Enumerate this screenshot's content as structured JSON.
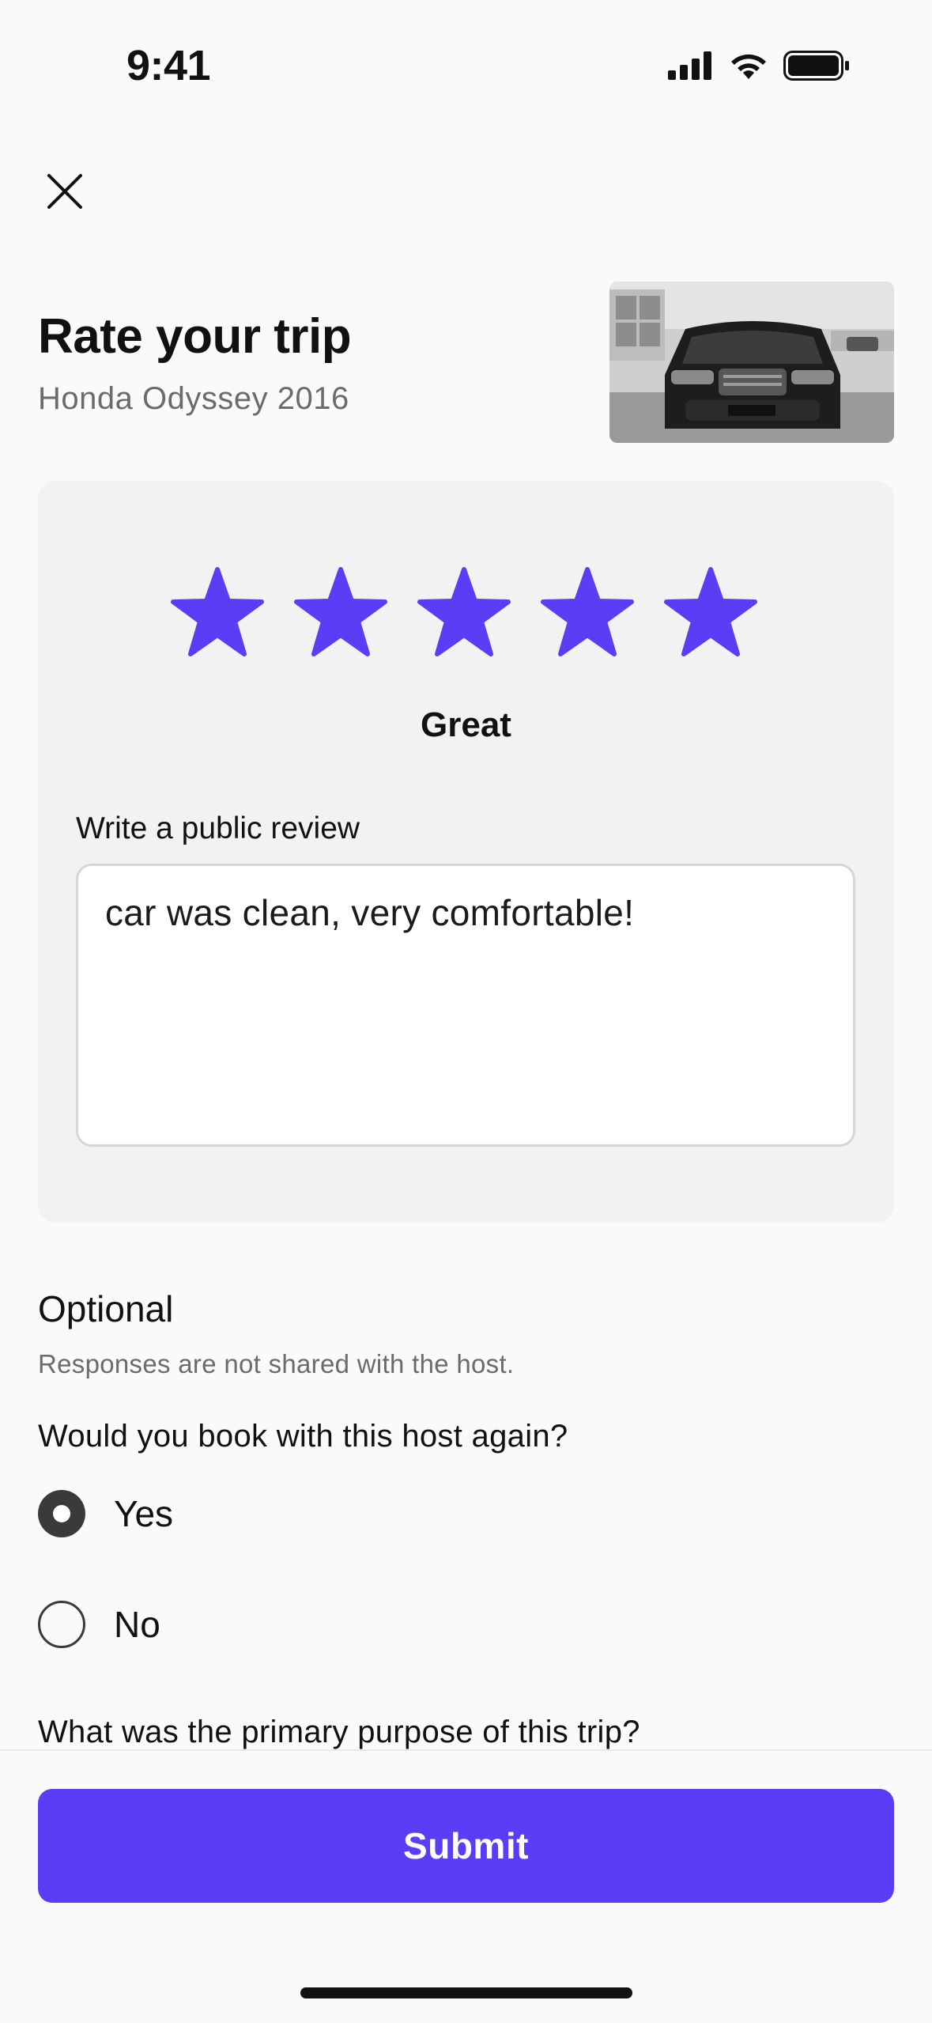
{
  "status_bar": {
    "time": "9:41"
  },
  "header": {
    "title": "Rate your trip",
    "subtitle": "Honda Odyssey 2016"
  },
  "rating": {
    "stars_selected": 5,
    "stars_total": 5,
    "label": "Great",
    "star_color": "#5b3df5"
  },
  "review": {
    "label": "Write a public review",
    "value": "car was clean, very comfortable!"
  },
  "optional": {
    "heading": "Optional",
    "note": "Responses are not shared with the host.",
    "question_rebook": "Would you book with this host again?",
    "options": [
      {
        "label": "Yes",
        "selected": true
      },
      {
        "label": "No",
        "selected": false
      }
    ],
    "question_purpose": "What was the primary purpose of this trip?"
  },
  "footer": {
    "submit_label": "Submit",
    "accent_color": "#5b3df5"
  }
}
